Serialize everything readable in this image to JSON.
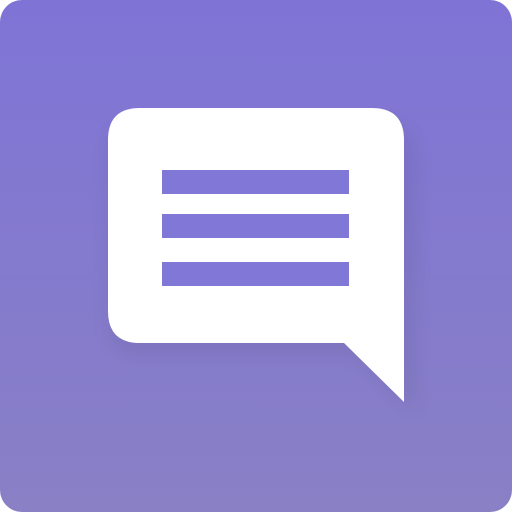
{
  "app_icon": {
    "icon": "message-bubble-icon",
    "colors": {
      "background_top": "#7f74d6",
      "background_bottom": "#8980c6",
      "bubble": "#ffffff",
      "text_lines": "#8177d6"
    }
  }
}
